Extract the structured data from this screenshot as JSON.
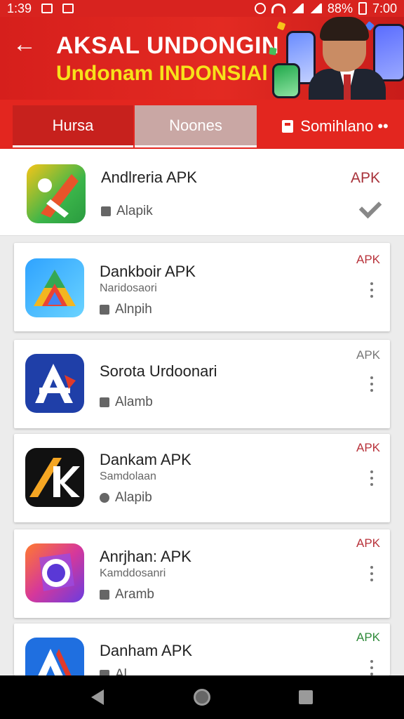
{
  "status_bar": {
    "time": "1:39",
    "battery": "88%",
    "clock_right": "7:00"
  },
  "header": {
    "back_label": "←",
    "title": "AKSAL UNDONGIN",
    "subtitle": "Undonam INDONSIAl"
  },
  "tabs": [
    {
      "label": "Hursa"
    },
    {
      "label": "Noones"
    },
    {
      "label": "Somihlano ••"
    }
  ],
  "apps": [
    {
      "name": "Andlreria APK",
      "sub": "",
      "meta": "Alapik",
      "badge": "APK",
      "badge_color": "#a8323a"
    },
    {
      "name": "Dankboir APK",
      "sub": "Naridosaori",
      "meta": "Alnpih",
      "badge": "APK",
      "badge_color": "#b8323a"
    },
    {
      "name": "Sorota Urdoonari",
      "sub": "",
      "meta": "Alamb",
      "badge": "APK",
      "badge_color": "#777777"
    },
    {
      "name": "Dankam APK",
      "sub": "Samdolaan",
      "meta": "Alapib",
      "badge": "APK",
      "badge_color": "#b8323a"
    },
    {
      "name": "Anrjhan: APK",
      "sub": "Kamddosanri",
      "meta": "Aramb",
      "badge": "APK",
      "badge_color": "#b8323a"
    },
    {
      "name": "Danham APK",
      "sub": "",
      "meta": "Al",
      "badge": "APK",
      "badge_color": "#2f8a3a"
    }
  ],
  "colors": {
    "brand_red": "#e3261f",
    "accent_yellow": "#f7e21a"
  }
}
